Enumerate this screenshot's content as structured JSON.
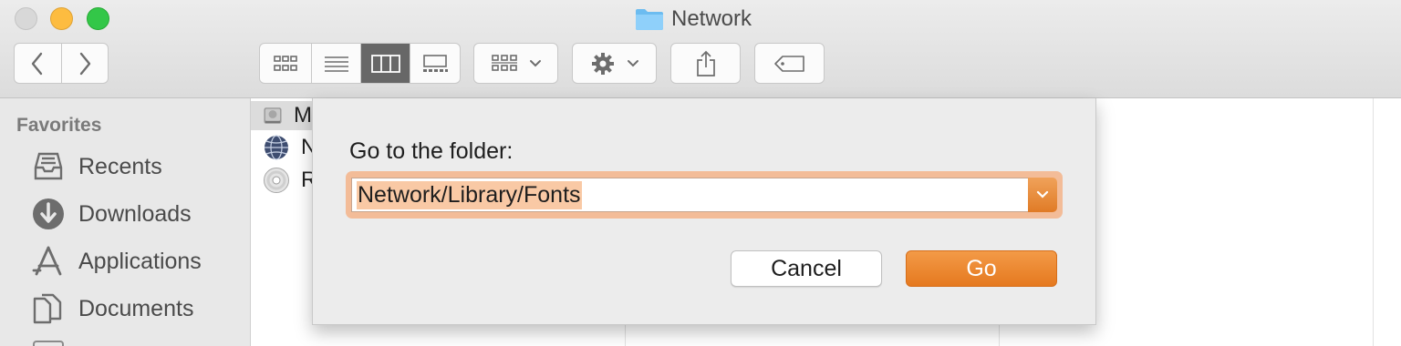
{
  "window": {
    "title": "Network",
    "folder_icon": "folder-icon"
  },
  "toolbar": {
    "back_icon": "chevron-left-icon",
    "forward_icon": "chevron-right-icon",
    "view_modes": [
      "icon-view-icon",
      "list-view-icon",
      "column-view-icon",
      "gallery-view-icon"
    ],
    "active_view": "column-view-icon",
    "group_icon": "group-icon",
    "action_icon": "gear-icon",
    "share_icon": "share-icon",
    "tag_icon": "tag-icon"
  },
  "sidebar": {
    "heading": "Favorites",
    "items": [
      {
        "label": "Recents",
        "icon": "recents-icon"
      },
      {
        "label": "Downloads",
        "icon": "downloads-icon"
      },
      {
        "label": "Applications",
        "icon": "applications-icon"
      },
      {
        "label": "Documents",
        "icon": "documents-icon"
      }
    ]
  },
  "content": {
    "rows": [
      {
        "label": "M",
        "icon": "hard-drive-icon"
      },
      {
        "label": "N",
        "icon": "network-globe-icon"
      },
      {
        "label": "R",
        "icon": "disc-icon"
      }
    ]
  },
  "dialog": {
    "prompt": "Go to the folder:",
    "path_value": "Network/Library/Fonts",
    "cancel_label": "Cancel",
    "go_label": "Go"
  },
  "colors": {
    "accent": "#e8832a",
    "active_segment": "#676767"
  }
}
